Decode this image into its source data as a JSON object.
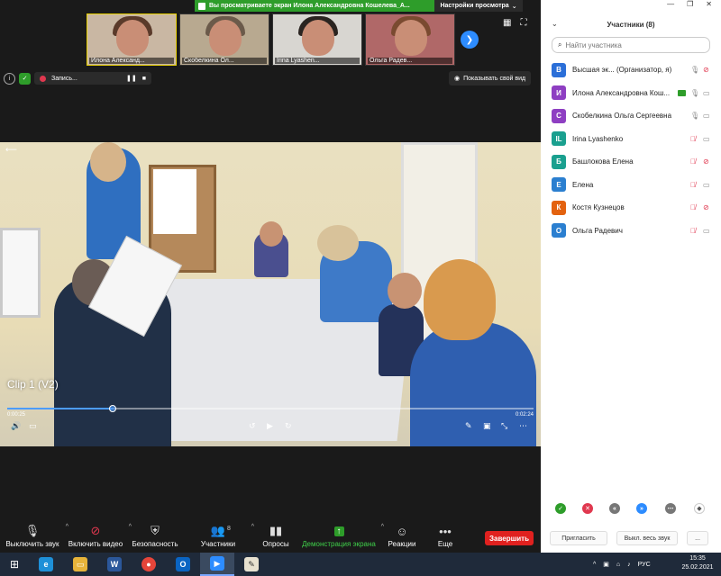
{
  "share_banner": {
    "message": "Вы просматриваете экран Илона Александровна Кошелева_А...",
    "options_label": "Настройки просмотра"
  },
  "thumbnails": [
    {
      "name": "Илона Александ...",
      "bg": "#c9b7a3",
      "hair": "#5a3a2a",
      "active": true
    },
    {
      "name": "Скобелкина Ол...",
      "bg": "#b8a990",
      "hair": "#6b5a4a",
      "active": false
    },
    {
      "name": "Irina Lyashen...",
      "bg": "#d8d6d1",
      "hair": "#2a2420",
      "active": false
    },
    {
      "name": "Ольга Радев...",
      "bg": "#b06868",
      "hair": "#7a4a30",
      "active": false
    }
  ],
  "recording": {
    "label": "Запись..."
  },
  "show_video_label": "Показывать свой вид",
  "video": {
    "title": "Clip 1 (V2)",
    "time_current": "0:00:25",
    "time_total": "0:02:24",
    "progress": 0.2
  },
  "toolbar": {
    "mute": "Выключить звук",
    "stop_video": "Включить видео",
    "security": "Безопасность",
    "participants": "Участники",
    "participants_count": "8",
    "polls": "Опросы",
    "share": "Демонстрация экрана",
    "reactions": "Реакции",
    "more": "Еще",
    "end": "Завершить"
  },
  "panel": {
    "title": "Участники (8)",
    "search_placeholder": "Найти участника",
    "participants": [
      {
        "initial": "В",
        "color": "#2b6fd8",
        "name": "Высшая эк... (Организатор, я)",
        "mic": "on",
        "cam": "off",
        "sharing": false
      },
      {
        "initial": "И",
        "color": "#8e3fc2",
        "name": "Илона Александровна Кош...",
        "mic": "on",
        "cam": "on",
        "sharing": true
      },
      {
        "initial": "С",
        "color": "#8e3fc2",
        "name": "Скобелкина Ольга Сергеевна",
        "mic": "on",
        "cam": "on",
        "sharing": false
      },
      {
        "initial": "IL",
        "color": "#1aa08f",
        "name": "Irina Lyashenko",
        "mic": "off",
        "cam": "on",
        "sharing": false
      },
      {
        "initial": "Б",
        "color": "#1aa08f",
        "name": "Башлокова Елена",
        "mic": "off",
        "cam": "off",
        "sharing": false
      },
      {
        "initial": "Е",
        "color": "#2b7fd0",
        "name": "Елена",
        "mic": "off",
        "cam": "on",
        "sharing": false
      },
      {
        "initial": "К",
        "color": "#e3620f",
        "name": "Костя Кузнецов",
        "mic": "off",
        "cam": "off",
        "sharing": false
      },
      {
        "initial": "О",
        "color": "#2b7fd0",
        "name": "Ольга Радевич",
        "mic": "off",
        "cam": "on",
        "sharing": false
      }
    ],
    "invite": "Пригласить",
    "mute_all": "Выкл. весь звук",
    "more": "..."
  },
  "taskbar": {
    "lang": "РУС",
    "time": "15:35",
    "date": "25.02.2021"
  },
  "colors": {
    "accent": "#2d8cff",
    "end": "#e0211f",
    "share_green": "#2e9d2a",
    "muted_red": "#e0384f"
  }
}
